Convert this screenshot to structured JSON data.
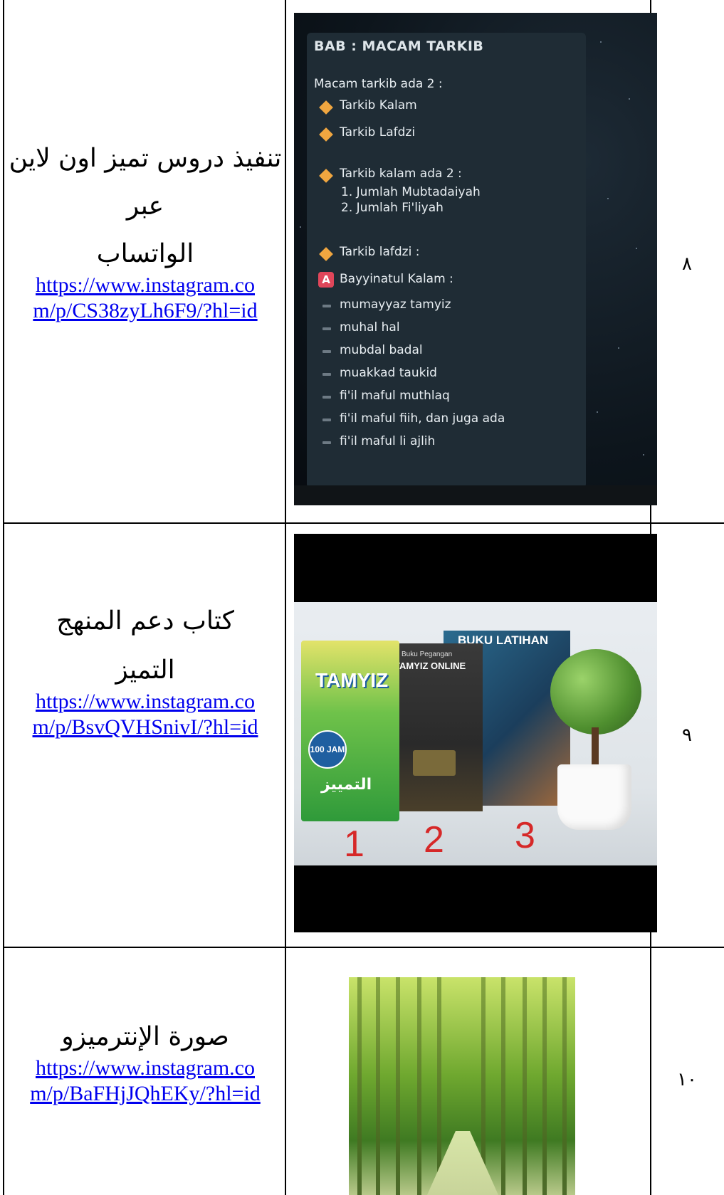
{
  "rows": [
    {
      "number": "٨",
      "description_lines": [
        "تنفيذ دروس تميز اون لاين",
        "عبر",
        "الواتساب"
      ],
      "url_line1": "https://www.instagram.co",
      "url_line2": "m/p/CS38zyLh6F9/?hl=id",
      "image": {
        "title": "BAB : MACAM TARKIB",
        "intro": "Macam tarkib ada 2 :",
        "items": [
          "Tarkib Kalam",
          "Tarkib Lafdzi"
        ],
        "kalam_heading": "Tarkib kalam ada 2 :",
        "kalam_list": [
          "1. Jumlah Mubtadaiyah",
          "2. Jumlah Fi'liyah"
        ],
        "lafdzi_heading": "Tarkib lafdzi :",
        "badge": "A",
        "bayyinatul": "Bayyinatul Kalam :",
        "sub_items": [
          "mumayyaz tamyiz",
          "muhal hal",
          "mubdal badal",
          "muakkad taukid",
          "fi'il maful muthlaq",
          "fi'il maful fiih, dan juga ada",
          "fi'il maful li ajlih"
        ]
      }
    },
    {
      "number": "٩",
      "description_lines": [
        "كتاب دعم المنهج",
        "التميز"
      ],
      "url_line1": "https://www.instagram.co",
      "url_line2": "m/p/BsvQVHSnivI/?hl=id",
      "image": {
        "book1_title": "TAMYIZ",
        "book1_arabic": "التمييز",
        "book1_badge": "100 JAM",
        "book2_top": "Buku Pegangan",
        "book2_title": "TAMYIZ ONLINE",
        "book3_title": "BUKU LATIHAN",
        "labels": [
          "1",
          "2",
          "3"
        ]
      }
    },
    {
      "number": "١٠",
      "description_lines": [
        "صورة الإنترميزو"
      ],
      "url_line1": "https://www.instagram.co",
      "url_line2": "m/p/BaFHjJQhEKy/?hl=id",
      "image": {}
    }
  ],
  "colors": {
    "link": "#0000ee",
    "note_bg": "#1f2c35",
    "diamond": "#f0a640",
    "badge": "#e0465a",
    "book_label": "#d62828"
  }
}
